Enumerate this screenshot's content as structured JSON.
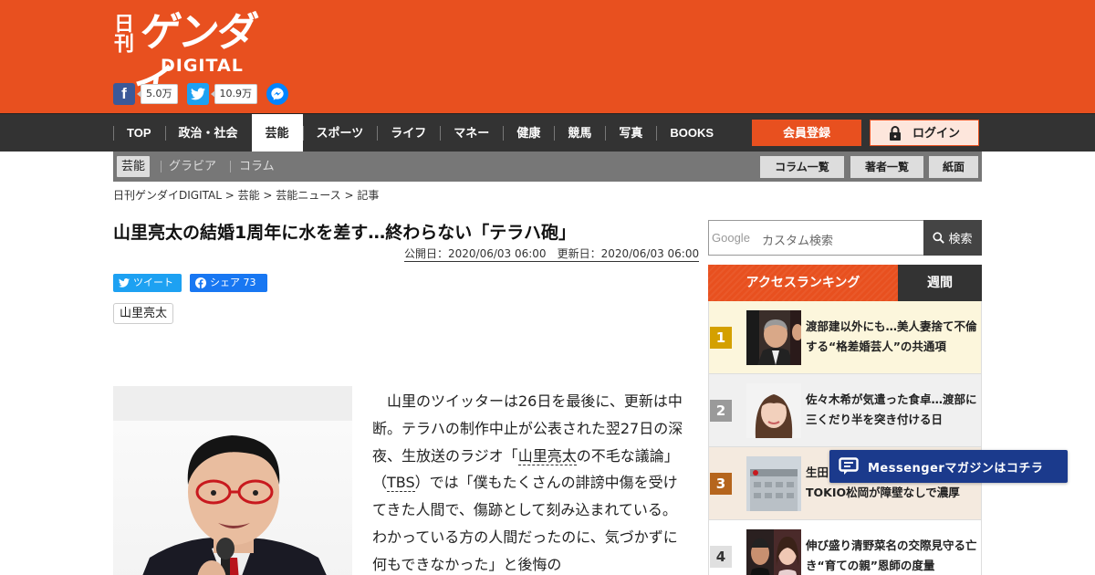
{
  "header": {
    "logo": {
      "nikkan": "日刊",
      "gendai": "ゲンダイ",
      "digital": "DIGITAL"
    },
    "social": [
      {
        "icon": "facebook-icon",
        "glyph": "f",
        "count": "5.0万"
      },
      {
        "icon": "twitter-icon",
        "glyph": "",
        "count": "10.9万"
      }
    ],
    "brand_color": "#e8501f"
  },
  "nav": {
    "items": [
      "TOP",
      "政治・社会",
      "芸能",
      "スポーツ",
      "ライフ",
      "マネー",
      "健康",
      "競馬",
      "写真",
      "BOOKS"
    ],
    "active": "芸能",
    "register_label": "会員登録",
    "login_label": "ログイン"
  },
  "subnav": {
    "items": [
      "芸能",
      "グラビア",
      "コラム"
    ],
    "buttons": [
      "コラム一覧",
      "著者一覧",
      "紙面"
    ]
  },
  "breadcrumb": "日刊ゲンダイDIGITAL > 芸能 > 芸能ニュース > 記事",
  "article": {
    "title": "山里亮太の結婚1周年に水を差す…終わらない「テラハ砲」",
    "published": "公開日：2020/06/03 06:00",
    "updated": "更新日：2020/06/03 06:00",
    "tweet_label": "ツイート",
    "share_label": "シェア 73",
    "tag": "山里亮太",
    "body": {
      "p1": "山里のツイッターは26日を最後に、更新は中断。テラハの制作中止が公表された翌27日の深夜、生放送のラジオ「",
      "link1": "山里亮太",
      "p2": "の不毛な議論」（",
      "link2": "TBS",
      "p3": "）では「僕もたくさんの誹謗中傷を受けてきた人間で、傷跡として刻み込まれている。わかっている方の人間だったのに、気づかずに何もできなかった」と後悔の"
    }
  },
  "sidebar": {
    "search": {
      "google_label": "Google",
      "placeholder": "カスタム検索",
      "button": "検索"
    },
    "ranking": {
      "title": "アクセスランキング",
      "period": "週間",
      "items": [
        {
          "rank": "1",
          "text": "渡部建以外にも…美人妻捨て不倫する“格差婚芸人”の共通項",
          "color": "#d4a000"
        },
        {
          "rank": "2",
          "text": "佐々木希が気遣った食卓…渡部に三くだり半を突き付ける日",
          "color": "#9a9a9a"
        },
        {
          "rank": "3",
          "text": "生田…TOKIO松岡が障壁なしで濃厚",
          "line1": "生田",
          "line2": "TOKIO松岡が障壁なしで濃厚",
          "color": "#b5651d"
        },
        {
          "rank": "4",
          "text": "伸び盛り清野菜名の交際見守る亡き“育ての親”恩師の度量",
          "color": "#e0e0e0"
        }
      ]
    }
  },
  "messenger_float": "Messengerマガジンはコチラ"
}
